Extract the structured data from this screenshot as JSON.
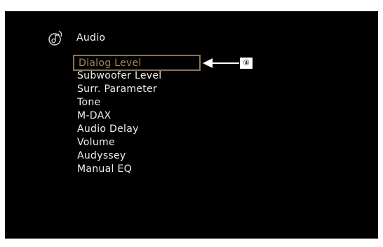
{
  "header": {
    "title": "Audio",
    "icon": "audio-note-icon"
  },
  "menu": {
    "items": [
      {
        "label": "Dialog Level",
        "selected": true
      },
      {
        "label": "Subwoofer Level"
      },
      {
        "label": "Surr. Parameter"
      },
      {
        "label": "Tone"
      },
      {
        "label": "M-DAX"
      },
      {
        "label": "Audio Delay"
      },
      {
        "label": "Volume"
      },
      {
        "label": "Audyssey"
      },
      {
        "label": "Manual EQ"
      }
    ]
  },
  "callout": {
    "label": "④"
  },
  "colors": {
    "background": "#000000",
    "text": "#f0f0f0",
    "selection": "#8a7452"
  }
}
